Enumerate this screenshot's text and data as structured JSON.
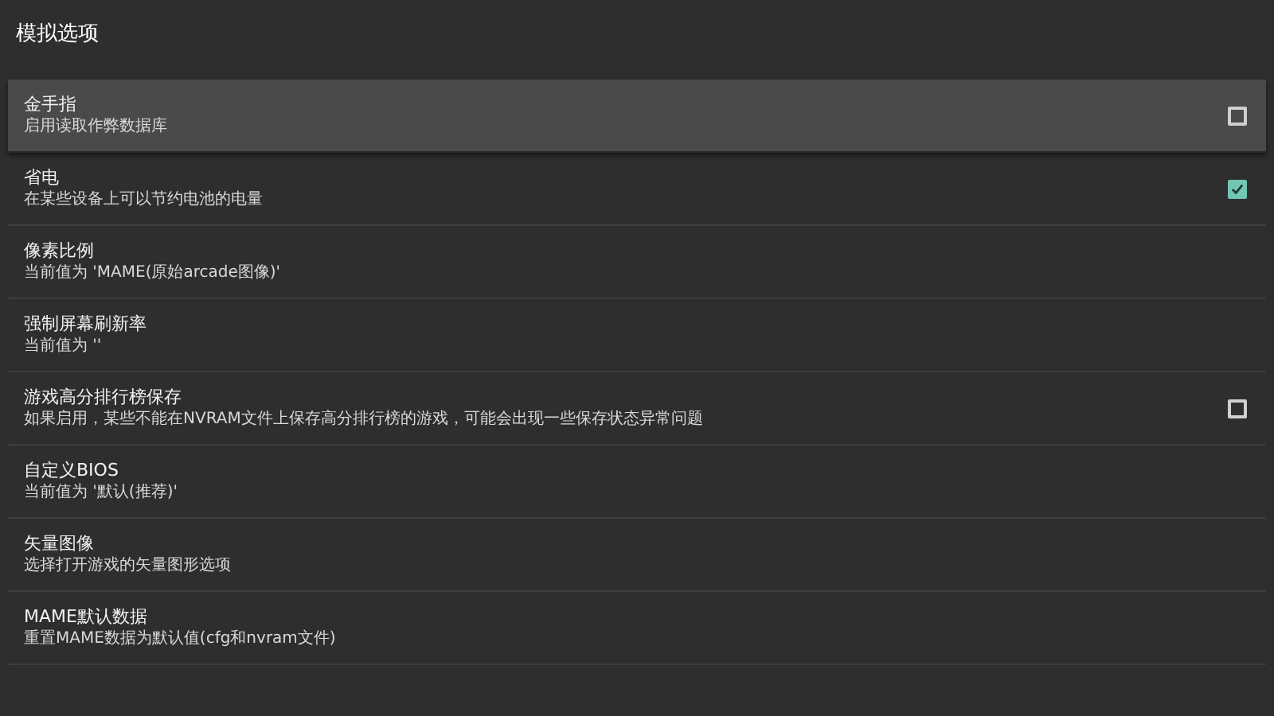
{
  "screen": {
    "title": "模拟选项"
  },
  "options": [
    {
      "kind": "checkbox",
      "title": "金手指",
      "summary": "启用读取作弊数据库",
      "checked": false,
      "selected": true
    },
    {
      "kind": "checkbox",
      "title": "省电",
      "summary": "在某些设备上可以节约电池的电量",
      "checked": true,
      "selected": false
    },
    {
      "kind": "plain",
      "title": "像素比例",
      "summary": "当前值为 'MAME(原始arcade图像)'",
      "selected": false
    },
    {
      "kind": "plain",
      "title": "强制屏幕刷新率",
      "summary": "当前值为 ''",
      "selected": false
    },
    {
      "kind": "checkbox",
      "title": "游戏高分排行榜保存",
      "summary": "如果启用，某些不能在NVRAM文件上保存高分排行榜的游戏，可能会出现一些保存状态异常问题",
      "checked": false,
      "selected": false
    },
    {
      "kind": "plain",
      "title": "自定义BIOS",
      "summary": "当前值为 '默认(推荐)'",
      "selected": false
    },
    {
      "kind": "plain",
      "title": "矢量图像",
      "summary": "选择打开游戏的矢量图形选项",
      "selected": false
    },
    {
      "kind": "plain",
      "title": "MAME默认数据",
      "summary": "重置MAME数据为默认值(cfg和nvram文件)",
      "selected": false
    }
  ]
}
